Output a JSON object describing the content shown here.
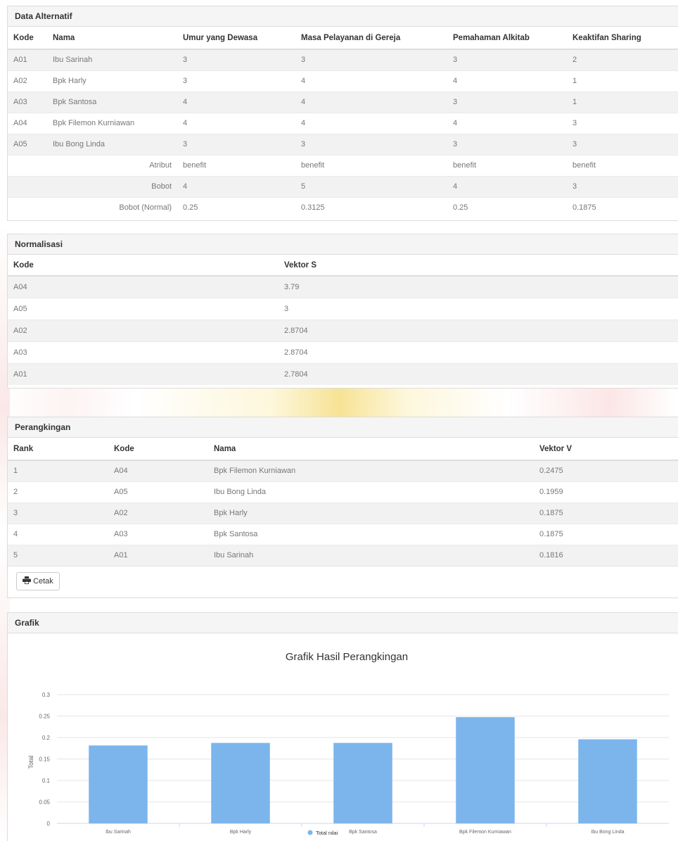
{
  "data_alternatif": {
    "title": "Data Alternatif",
    "headers": [
      "Kode",
      "Nama",
      "Umur yang Dewasa",
      "Masa Pelayanan di Gereja",
      "Pemahaman Alkitab",
      "Keaktifan Sharing"
    ],
    "rows": [
      [
        "A01",
        "Ibu Sarinah",
        "3",
        "3",
        "3",
        "2"
      ],
      [
        "A02",
        "Bpk Harly",
        "3",
        "4",
        "4",
        "1"
      ],
      [
        "A03",
        "Bpk Santosa",
        "4",
        "4",
        "3",
        "1"
      ],
      [
        "A04",
        "Bpk Filemon Kurniawan",
        "4",
        "4",
        "4",
        "3"
      ],
      [
        "A05",
        "Ibu Bong Linda",
        "3",
        "3",
        "3",
        "3"
      ]
    ],
    "atribut_label": "Atribut",
    "atribut": [
      "benefit",
      "benefit",
      "benefit",
      "benefit"
    ],
    "bobot_label": "Bobot",
    "bobot": [
      "4",
      "5",
      "4",
      "3"
    ],
    "bobot_normal_label": "Bobot (Normal)",
    "bobot_normal": [
      "0.25",
      "0.3125",
      "0.25",
      "0.1875"
    ]
  },
  "normalisasi": {
    "title": "Normalisasi",
    "headers": [
      "Kode",
      "Vektor S"
    ],
    "rows": [
      [
        "A04",
        "3.79"
      ],
      [
        "A05",
        "3"
      ],
      [
        "A02",
        "2.8704"
      ],
      [
        "A03",
        "2.8704"
      ],
      [
        "A01",
        "2.7804"
      ]
    ]
  },
  "perangkingan": {
    "title": "Perangkingan",
    "headers": [
      "Rank",
      "Kode",
      "Nama",
      "Vektor V"
    ],
    "rows": [
      [
        "1",
        "A04",
        "Bpk Filemon Kurniawan",
        "0.2475"
      ],
      [
        "2",
        "A05",
        "Ibu Bong Linda",
        "0.1959"
      ],
      [
        "3",
        "A02",
        "Bpk Harly",
        "0.1875"
      ],
      [
        "4",
        "A03",
        "Bpk Santosa",
        "0.1875"
      ],
      [
        "5",
        "A01",
        "Ibu Sarinah",
        "0.1816"
      ]
    ],
    "print_button": "Cetak",
    "print_icon": "print-icon"
  },
  "grafik": {
    "title": "Grafik"
  },
  "chart_data": {
    "type": "bar",
    "title": "Grafik Hasil Perangkingan",
    "ylabel": "Total",
    "xlabel": "",
    "categories": [
      "Ibu Sarinah",
      "Bpk Harly",
      "Bpk Santosa",
      "Bpk Filemon Kurniawan",
      "Ibu Bong Linda"
    ],
    "series": [
      {
        "name": "Total nilai",
        "values": [
          0.1816,
          0.1875,
          0.1875,
          0.2475,
          0.1959
        ]
      }
    ],
    "ylim": [
      0,
      0.3
    ],
    "yticks": [
      "0",
      "0.05",
      "0.1",
      "0.15",
      "0.2",
      "0.25",
      "0.3"
    ],
    "bar_color": "#7cb5ec",
    "grid": true,
    "legend": "bottom-center"
  }
}
